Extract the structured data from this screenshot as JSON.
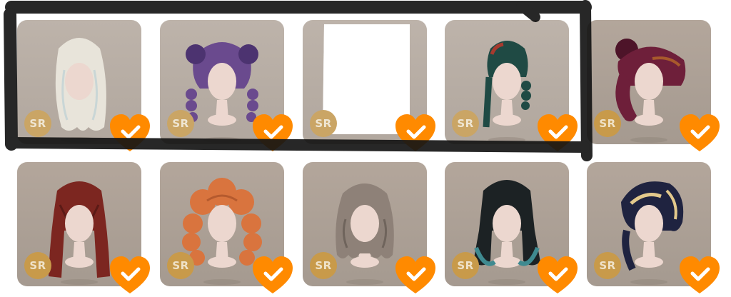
{
  "grid": {
    "rows": [
      [
        {
          "name": "white-wavy-long",
          "rarity": "SR",
          "hair_color": "#e8e4da",
          "accent": "#c9d6d6",
          "style": "long-wavy",
          "favorited": true,
          "dimmed": true
        },
        {
          "name": "purple-twin-braids",
          "rarity": "SR",
          "hair_color": "#6a4a8e",
          "accent": "#4c3370",
          "style": "twin-braids",
          "favorited": true,
          "dimmed": true
        },
        {
          "name": "censored-item",
          "rarity": "SR",
          "hair_color": "#ffffff",
          "accent": "#ffffff",
          "style": "censored",
          "favorited": true,
          "dimmed": true
        },
        {
          "name": "teal-red-side-braids",
          "rarity": "SR",
          "hair_color": "#1f4a44",
          "accent": "#a63a2e",
          "style": "side-braids",
          "favorited": true,
          "dimmed": true
        },
        {
          "name": "burgundy-bun-ponytail",
          "rarity": "SR",
          "hair_color": "#6e1f3a",
          "accent": "#4d1429",
          "style": "bun-ponytail",
          "favorited": true,
          "dimmed": false
        }
      ],
      [
        {
          "name": "red-long-straight",
          "rarity": "SR",
          "hair_color": "#7c2620",
          "accent": "#5a1a16",
          "style": "long-straight",
          "favorited": true,
          "dimmed": false
        },
        {
          "name": "orange-curly",
          "rarity": "SR",
          "hair_color": "#d9743e",
          "accent": "#b55a2e",
          "style": "curly",
          "favorited": true,
          "dimmed": false
        },
        {
          "name": "gray-wavy-medium",
          "rarity": "SR",
          "hair_color": "#8e8178",
          "accent": "#6f645c",
          "style": "wavy-medium",
          "favorited": true,
          "dimmed": false
        },
        {
          "name": "black-teal-hime",
          "rarity": "SR",
          "hair_color": "#1c2224",
          "accent": "#3f8a90",
          "style": "hime",
          "favorited": true,
          "dimmed": false
        },
        {
          "name": "navy-gold-streak",
          "rarity": "SR",
          "hair_color": "#1f2340",
          "accent": "#e3c98c",
          "style": "swept",
          "favorited": true,
          "dimmed": false
        }
      ]
    ]
  },
  "colors": {
    "card_bg": "#a89d93",
    "badge_bg": "#c89a4a",
    "favorite": "#ff8a00",
    "skin": "#ecd7cf",
    "marker": "#111111"
  }
}
